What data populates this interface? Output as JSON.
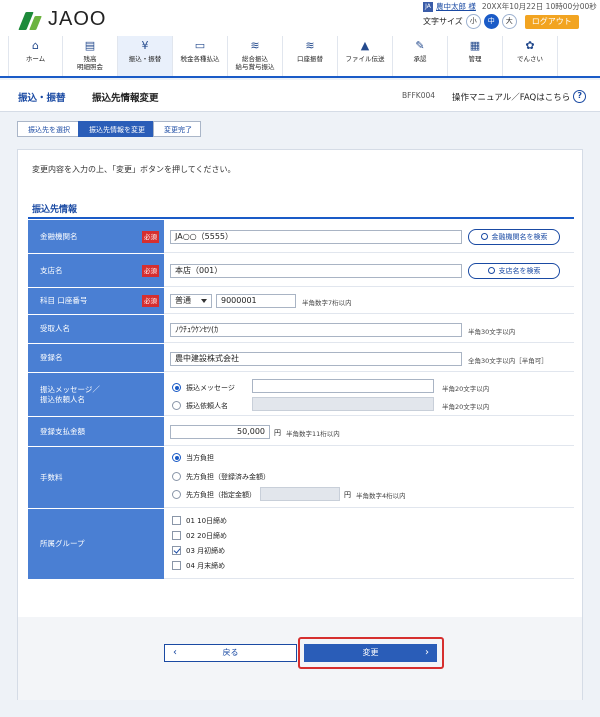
{
  "header": {
    "logo_text": "JAOO",
    "user_badge": "JA",
    "user_name": "農中太郎 様",
    "datetime": "20XX年10月22日 10時00分00秒",
    "font_size_label": "文字サイズ",
    "font_sizes": [
      "小",
      "中",
      "大"
    ],
    "logout_label": "ログアウト"
  },
  "nav": [
    {
      "icon": "home-icon",
      "glyph": "⌂",
      "label": "ホーム"
    },
    {
      "icon": "document-icon",
      "glyph": "▤",
      "label": "残高\n明細照会"
    },
    {
      "icon": "yen-coin-icon",
      "glyph": "¥",
      "label": "振込・振替"
    },
    {
      "icon": "tax-payment-icon",
      "glyph": "▭",
      "label": "税金各種払込"
    },
    {
      "icon": "coins-stack-icon",
      "glyph": "≋",
      "label": "総合振込\n給与賞与振込"
    },
    {
      "icon": "account-transfer-icon",
      "glyph": "≋",
      "label": "口座振替"
    },
    {
      "icon": "file-transfer-icon",
      "glyph": "▲",
      "label": "ファイル伝送"
    },
    {
      "icon": "approval-icon",
      "glyph": "✎",
      "label": "承認"
    },
    {
      "icon": "management-icon",
      "glyph": "▦",
      "label": "管理"
    },
    {
      "icon": "e-seal-icon",
      "glyph": "✿",
      "label": "でんさい"
    }
  ],
  "titlebar": {
    "section": "振込・振替",
    "title": "振込先情報変更",
    "code": "BFFK004",
    "help": "操作マニュアル／FAQはこちら"
  },
  "steps": [
    "振込先を選択",
    "振込先情報を変更",
    "変更完了"
  ],
  "instruction": "変更内容を入力の上、「変更」ボタンを押してください。",
  "section_title": "振込先情報",
  "required_label": "必須",
  "form": {
    "bank": {
      "label": "金融機関名",
      "value": "JA○○（5555）",
      "button": "金融機関名を検索"
    },
    "branch": {
      "label": "支店名",
      "value": "本店（001）",
      "button": "支店名を検索"
    },
    "account": {
      "label": "科目 口座番号",
      "type": "普通",
      "number": "9000001",
      "note": "半角数字7桁以内"
    },
    "recipient": {
      "label": "受取人名",
      "value": "ﾉｳﾁｭｳｹﾝｾﾂ(ｶ",
      "note": "半角30文字以内"
    },
    "registered": {
      "label": "登録名",
      "value": "農中建設株式会社",
      "note": "全角30文字以内［半角可］"
    },
    "message": {
      "label_line1": "振込メッセージ／",
      "label_line2": "振込依頼人名",
      "opt1": "振込メッセージ",
      "opt1_note": "半角20文字以内",
      "opt2": "振込依頼人名",
      "opt2_note": "半角20文字以内"
    },
    "amount": {
      "label": "登録支払金額",
      "value": "50,000",
      "unit": "円",
      "note": "半角数字11桁以内"
    },
    "fee": {
      "label": "手数料",
      "opt1": "当方負担",
      "opt2": "先方負担（登録済み金額）",
      "opt3": "先方負担（指定金額）",
      "unit": "円",
      "note": "半角数字4桁以内"
    },
    "group": {
      "label": "所属グループ",
      "items": [
        {
          "label": "01 10日締め",
          "checked": false
        },
        {
          "label": "02 20日締め",
          "checked": false
        },
        {
          "label": "03 月初締め",
          "checked": true
        },
        {
          "label": "04 月末締め",
          "checked": false
        }
      ]
    }
  },
  "buttons": {
    "back": "戻る",
    "submit": "変更"
  }
}
